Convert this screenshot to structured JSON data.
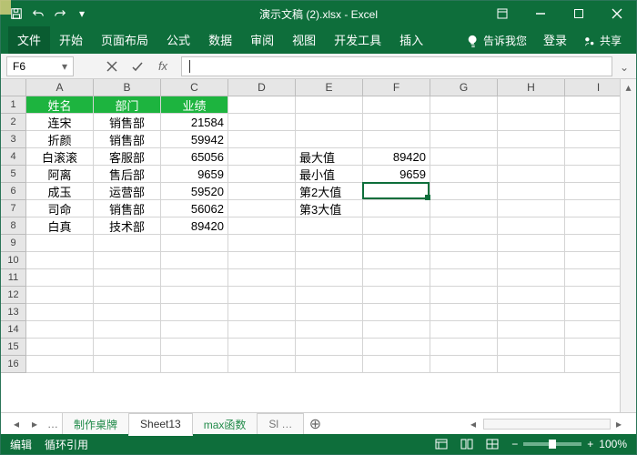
{
  "title": "演示文稿 (2).xlsx - Excel",
  "ribbon": {
    "file": "文件",
    "tabs": [
      "开始",
      "页面布局",
      "公式",
      "数据",
      "审阅",
      "视图",
      "开发工具",
      "插入"
    ],
    "tell": "告诉我您",
    "login": "登录",
    "share": "共享"
  },
  "namebox": "F6",
  "formula": "",
  "col_headers": [
    "A",
    "B",
    "C",
    "D",
    "E",
    "F",
    "G",
    "H",
    "I"
  ],
  "row_count": 16,
  "headers": {
    "A": "姓名",
    "B": "部门",
    "C": "业绩"
  },
  "rows": [
    {
      "A": "连宋",
      "B": "销售部",
      "C": "21584"
    },
    {
      "A": "折颜",
      "B": "销售部",
      "C": "59942"
    },
    {
      "A": "白滚滚",
      "B": "客服部",
      "C": "65056"
    },
    {
      "A": "阿离",
      "B": "售后部",
      "C": "9659"
    },
    {
      "A": "成玉",
      "B": "运营部",
      "C": "59520"
    },
    {
      "A": "司命",
      "B": "销售部",
      "C": "56062"
    },
    {
      "A": "白真",
      "B": "技术部",
      "C": "89420"
    }
  ],
  "stats": [
    {
      "label": "最大值",
      "value": "89420"
    },
    {
      "label": "最小值",
      "value": "9659"
    },
    {
      "label": "第2大值",
      "value": ""
    },
    {
      "label": "第3大值",
      "value": ""
    }
  ],
  "sheet_tabs": [
    "制作桌牌",
    "Sheet13",
    "max函数",
    "Sl"
  ],
  "active_sheet": 1,
  "status": {
    "mode": "编辑",
    "circ": "循环引用",
    "zoom": "100%"
  }
}
